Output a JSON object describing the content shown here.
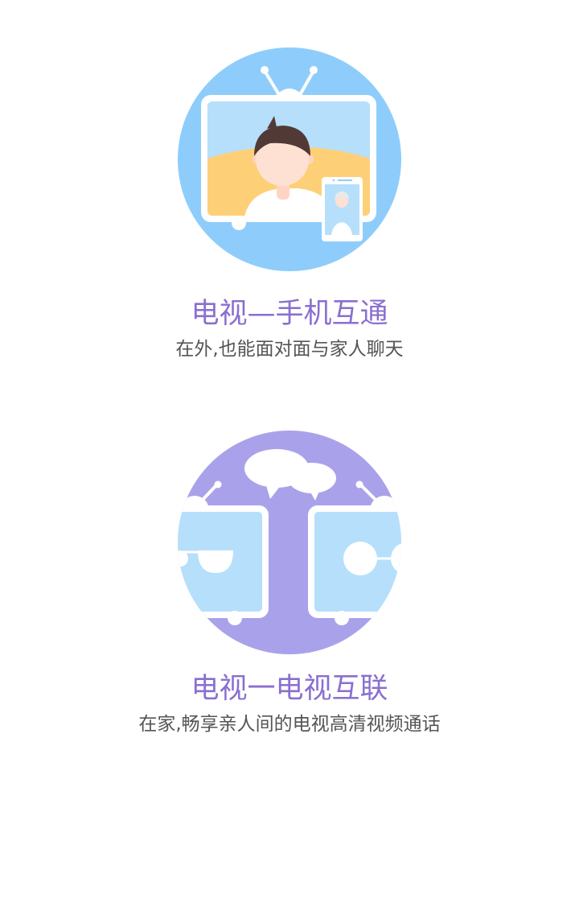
{
  "features": [
    {
      "title": "电视—手机互通",
      "subtitle": "在外,也能面对面与家人聊天",
      "icon": "tv-phone-call-icon",
      "circle_color": "#8ecdfb"
    },
    {
      "title": "电视一电视互联",
      "subtitle": "在家,畅享亲人间的电视高清视频通话",
      "icon": "tv-tv-chat-icon",
      "circle_color": "#a9a2ea"
    }
  ],
  "colors": {
    "title": "#8a6fd0",
    "subtitle": "#555555",
    "screen_light": "#b6dffb",
    "sun_yellow": "#fdd078"
  }
}
